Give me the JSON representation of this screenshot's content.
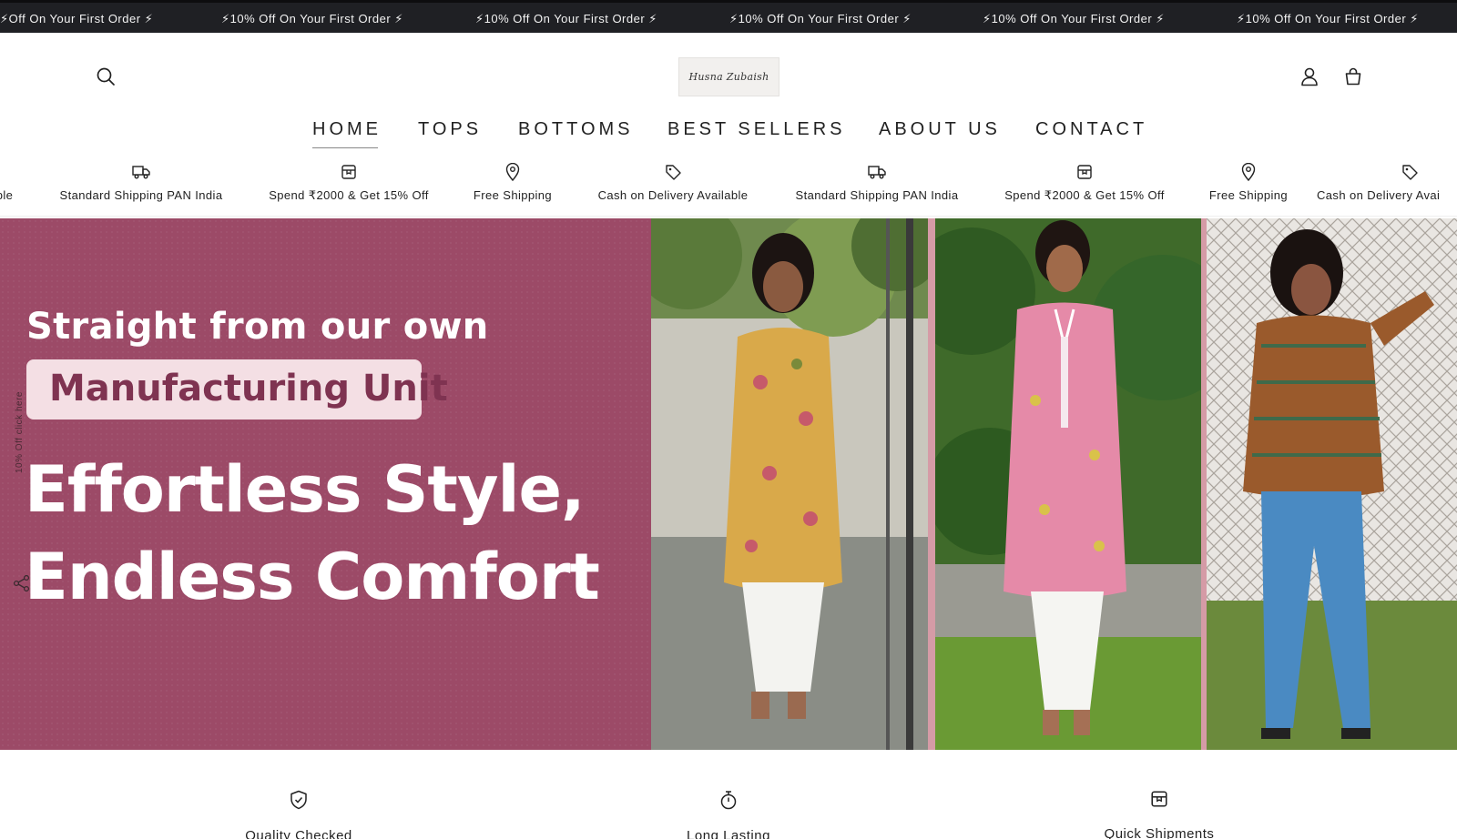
{
  "announcement": {
    "items": [
      "⚡Off On Your First Order ⚡",
      "⚡10% Off On Your First Order ⚡",
      "⚡10% Off On Your First Order ⚡",
      "⚡10% Off On Your First Order ⚡",
      "⚡10% Off On Your First Order ⚡",
      "⚡10% Off On Your First Order ⚡"
    ]
  },
  "header": {
    "logo_text": "Husna Zubaish",
    "icons": {
      "search": "search-icon",
      "account": "user-icon",
      "cart": "bag-icon"
    }
  },
  "nav": {
    "items": [
      "HOME",
      "TOPS",
      "BOTTOMS",
      "BEST SELLERS",
      "ABOUT US",
      "CONTACT"
    ],
    "active": "HOME"
  },
  "features": {
    "items": [
      {
        "label": "ble",
        "icon": "tag-icon"
      },
      {
        "label": "Standard Shipping PAN India",
        "icon": "truck-icon"
      },
      {
        "label": "Spend ₹2000 & Get 15% Off",
        "icon": "box-icon"
      },
      {
        "label": "Free Shipping",
        "icon": "location-pin-icon"
      },
      {
        "label": "Cash on Delivery Available",
        "icon": "tag-icon"
      },
      {
        "label": "Standard Shipping PAN India",
        "icon": "truck-icon"
      },
      {
        "label": "Spend ₹2000 & Get 15% Off",
        "icon": "box-icon"
      },
      {
        "label": "Free Shipping",
        "icon": "location-pin-icon"
      },
      {
        "label": "Cash on Delivery Avai",
        "icon": "tag-icon"
      }
    ]
  },
  "hero": {
    "subtitle": "Straight from our own",
    "highlight": "Manufacturing Unit",
    "title_line1": "Effortless Style,",
    "title_line2": "Endless Comfort",
    "bg_color": "#9c4a67",
    "highlight_color": "#7f3351"
  },
  "side_tab": {
    "label": "10% Off click here",
    "icon": "share-icon"
  },
  "trust": {
    "items": [
      {
        "label": "Quality Checked",
        "icon": "shield-check-icon"
      },
      {
        "label": "Long Lasting",
        "icon": "stopwatch-icon"
      },
      {
        "label": "Quick Shipments",
        "icon": "box-icon"
      }
    ]
  }
}
